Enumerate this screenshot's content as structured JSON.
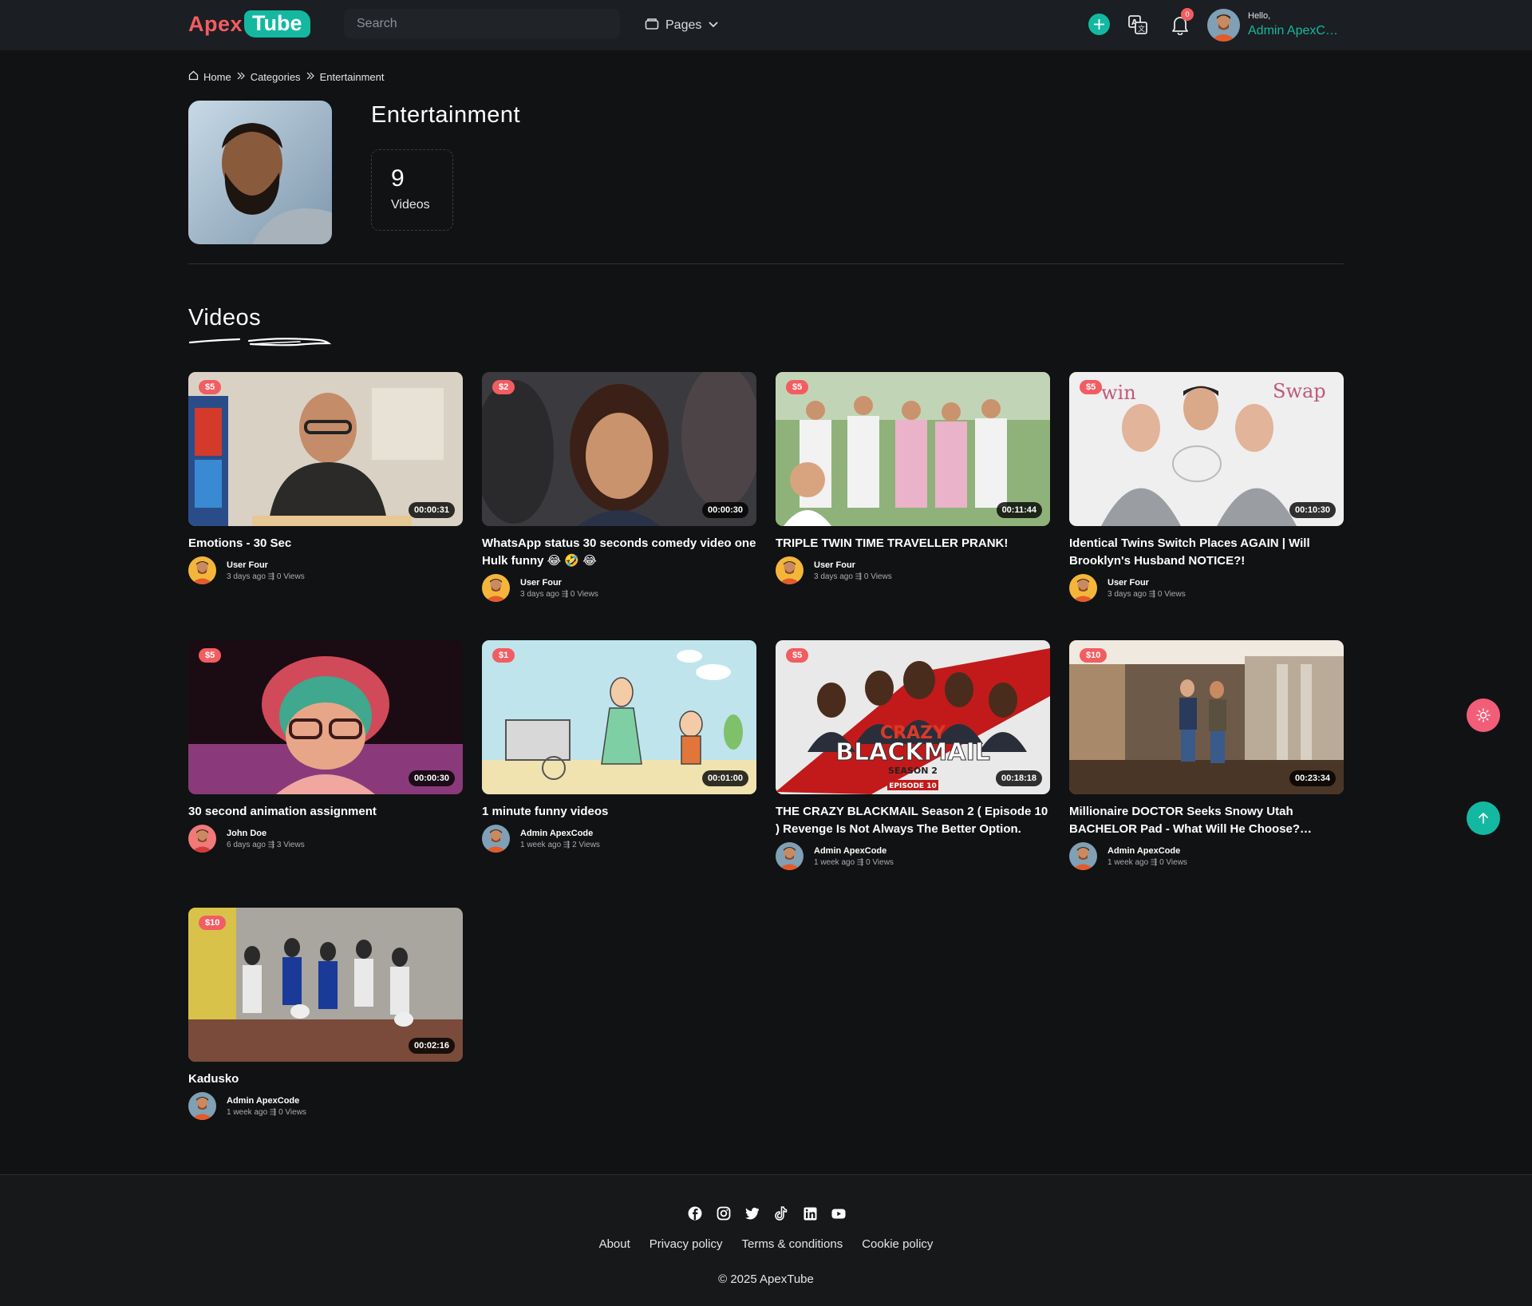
{
  "header": {
    "logo_part1": "Apex",
    "logo_part2": "Tube",
    "search_placeholder": "Search",
    "pages_label": "Pages",
    "notification_count": "0",
    "greeting": "Hello,",
    "user_name": "Admin ApexCode"
  },
  "breadcrumb": {
    "home": "Home",
    "categories": "Categories",
    "current": "Entertainment"
  },
  "category": {
    "title": "Entertainment",
    "video_count": "9",
    "video_count_label": "Videos"
  },
  "section_title": "Videos",
  "videos": [
    {
      "title": "Emotions - 30 Sec",
      "price": "$5",
      "duration": "00:00:31",
      "user": "User Four",
      "stats": "3 days ago  ⇶  0 Views"
    },
    {
      "title": "WhatsApp status 30 seconds comedy video one Hulk funny 😂 🤣 😂",
      "price": "$2",
      "duration": "00:00:30",
      "user": "User Four",
      "stats": "3 days ago  ⇶  0 Views"
    },
    {
      "title": "TRIPLE TWIN TIME TRAVELLER PRANK!",
      "price": "$5",
      "duration": "00:11:44",
      "user": "User Four",
      "stats": "3 days ago  ⇶  0 Views"
    },
    {
      "title": "Identical Twins Switch Places AGAIN | Will Brooklyn's Husband NOTICE?!",
      "price": "$5",
      "duration": "00:10:30",
      "user": "User Four",
      "stats": "3 days ago  ⇶  0 Views"
    },
    {
      "title": "30 second animation assignment",
      "price": "$5",
      "duration": "00:00:30",
      "user": "John Doe",
      "stats": "6 days ago  ⇶  3 Views"
    },
    {
      "title": "1 minute funny videos",
      "price": "$1",
      "duration": "00:01:00",
      "user": "Admin ApexCode",
      "stats": "1 week ago  ⇶  2 Views"
    },
    {
      "title": "THE CRAZY BLACKMAIL Season 2 ( Episode 10 ) Revenge Is Not Always The Better Option.",
      "price": "$5",
      "duration": "00:18:18",
      "user": "Admin ApexCode",
      "stats": "1 week ago  ⇶  0 Views"
    },
    {
      "title": "Millionaire DOCTOR Seeks Snowy Utah BACHELOR Pad - What Will He Choose? PARKER",
      "price": "$10",
      "duration": "00:23:34",
      "user": "Admin ApexCode",
      "stats": "1 week ago  ⇶  0 Views"
    },
    {
      "title": "Kadusko",
      "price": "$10",
      "duration": "00:02:16",
      "user": "Admin ApexCode",
      "stats": "1 week ago  ⇶  0 Views"
    }
  ],
  "thumbnail_text": {
    "crazy_blackmail_line1": "CRAZY",
    "crazy_blackmail_line2": "BLACKMAIL",
    "crazy_blackmail_line3": "SEASON 2",
    "crazy_blackmail_line4": "EPISODE 10",
    "twin_swap_left": "win",
    "twin_swap_right": "Swap"
  },
  "footer": {
    "links": [
      "About",
      "Privacy policy",
      "Terms & conditions",
      "Cookie policy"
    ],
    "copyright": "© 2025 ApexTube",
    "socials": [
      "facebook-icon",
      "instagram-icon",
      "twitter-icon",
      "tiktok-icon",
      "linkedin-icon",
      "youtube-icon"
    ]
  },
  "colors": {
    "accent": "#14b8a0",
    "brand_red": "#f25d62",
    "background": "#111213",
    "header_bg": "#1b1e22"
  }
}
